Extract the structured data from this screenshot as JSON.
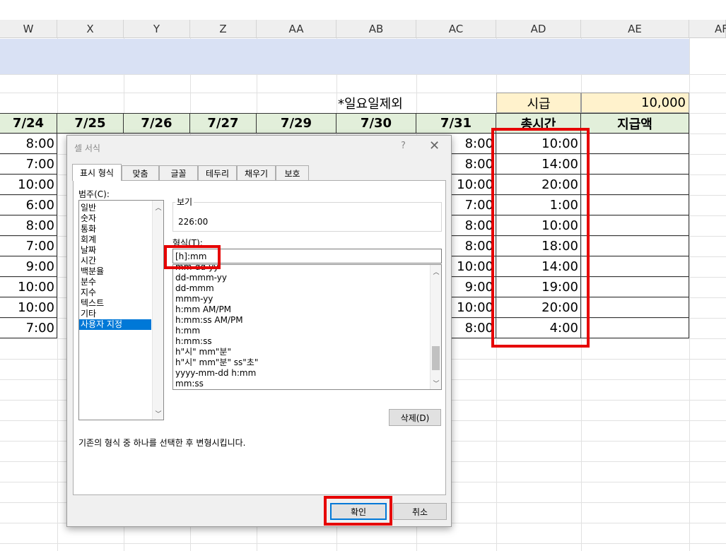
{
  "columns": [
    "W",
    "X",
    "Y",
    "Z",
    "AA",
    "AB",
    "AC",
    "AD",
    "AE",
    "AF"
  ],
  "sheet": {
    "note": "*일요일제외",
    "wage_label": "시급",
    "wage_value": "10,000",
    "headers": [
      "7/24",
      "7/25",
      "7/26",
      "7/27",
      "7/29",
      "7/30",
      "7/31",
      "총시간",
      "지급액"
    ],
    "col_w_values": [
      "8:00",
      "7:00",
      "10:00",
      "6:00",
      "8:00",
      "7:00",
      "9:00",
      "10:00",
      "10:00",
      "7:00"
    ],
    "col_ac_values": [
      "8:00",
      "8:00",
      "10:00",
      "7:00",
      "8:00",
      "8:00",
      "10:00",
      "9:00",
      "10:00",
      "8:00"
    ],
    "total_hours": [
      "10:00",
      "14:00",
      "20:00",
      "1:00",
      "10:00",
      "18:00",
      "14:00",
      "19:00",
      "20:00",
      "4:00"
    ]
  },
  "dialog": {
    "title": "셀 서식",
    "help": "?",
    "close": "✕",
    "tabs": [
      "표시 형식",
      "맞춤",
      "글꼴",
      "테두리",
      "채우기",
      "보호"
    ],
    "category_label": "범주(C):",
    "categories": [
      "일반",
      "숫자",
      "통화",
      "회계",
      "날짜",
      "시간",
      "백분율",
      "분수",
      "지수",
      "텍스트",
      "기타",
      "사용자 지정"
    ],
    "selected_category": "사용자 지정",
    "sample_label": "보기",
    "sample_value": "226:00",
    "type_label": "형식(T):",
    "type_value": "[h]:mm",
    "formats": [
      "mm-dd-yy",
      "dd-mmm-yy",
      "dd-mmm",
      "mmm-yy",
      "h:mm AM/PM",
      "h:mm:ss AM/PM",
      "h:mm",
      "h:mm:ss",
      "h\"시\" mm\"분\"",
      "h\"시\" mm\"분\" ss\"초\"",
      "yyyy-mm-dd h:mm",
      "mm:ss"
    ],
    "delete_button": "삭제(D)",
    "hint": "기존의 형식 중 하나를 선택한 후 변형시킵니다.",
    "ok_button": "확인",
    "cancel_button": "취소"
  },
  "colors": {
    "accent": "#0078d7",
    "highlight_red": "#e60000",
    "header_green": "#e2efda",
    "band_blue": "#d9e1f4",
    "wage_yellow": "#fff2cc"
  }
}
